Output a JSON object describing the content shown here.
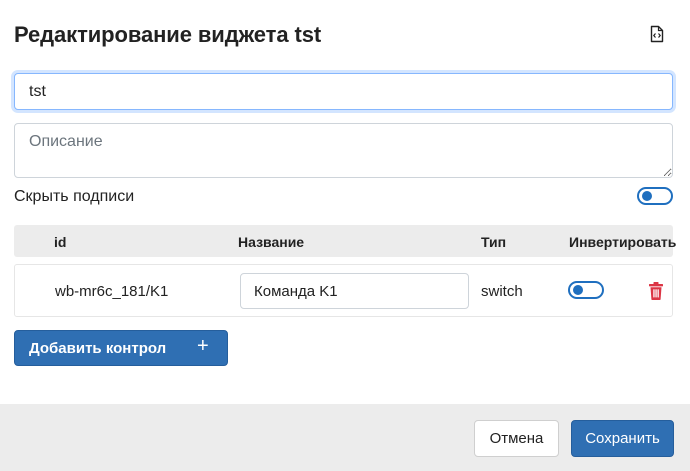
{
  "dialog": {
    "title": "Редактирование виджета tst",
    "name_value": "tst",
    "description_placeholder": "Описание",
    "hide_captions_label": "Скрыть подписи",
    "hide_captions_enabled": false
  },
  "table": {
    "headers": {
      "id": "id",
      "name": "Название",
      "type": "Тип",
      "invert": "Инвертировать"
    },
    "rows": [
      {
        "id": "wb-mr6c_181/K1",
        "name": "Команда K1",
        "type": "switch",
        "invert": false
      }
    ]
  },
  "add_control_label": "Добавить контрол",
  "add_control_icon": "plus-icon",
  "footer": {
    "cancel_label": "Отмена",
    "save_label": "Сохранить"
  },
  "colors": {
    "primary": "#2f6fb3",
    "delete": "#dc3545",
    "footer_bg": "#ececec"
  }
}
